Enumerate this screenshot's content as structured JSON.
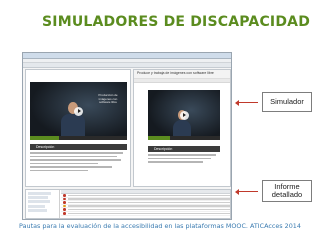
{
  "slide": {
    "title": "SIMULADORES DE DISCAPACIDAD",
    "footer": "Pautas para la evaluación de la accesibilidad en las plataformas MOOC. ATICAcces 2014"
  },
  "callouts": {
    "simulador": "Simulador",
    "informe": "Informe detallado"
  },
  "colors": {
    "title": "#5b8c1f",
    "footer": "#3a7bb0",
    "arrow": "#c0392b",
    "error_dot": "#c0392b",
    "warning_dot": "#e0a020"
  },
  "screenshot": {
    "right_pane_heading": "Produce y trabaja de imágenes con software libre",
    "description_label": "Descripción",
    "video_caption": "Producción de imágenes con software libre",
    "report_rows": [
      {
        "status": "error"
      },
      {
        "status": "error"
      },
      {
        "status": "error"
      },
      {
        "status": "warning"
      },
      {
        "status": "error"
      },
      {
        "status": "error"
      }
    ]
  }
}
